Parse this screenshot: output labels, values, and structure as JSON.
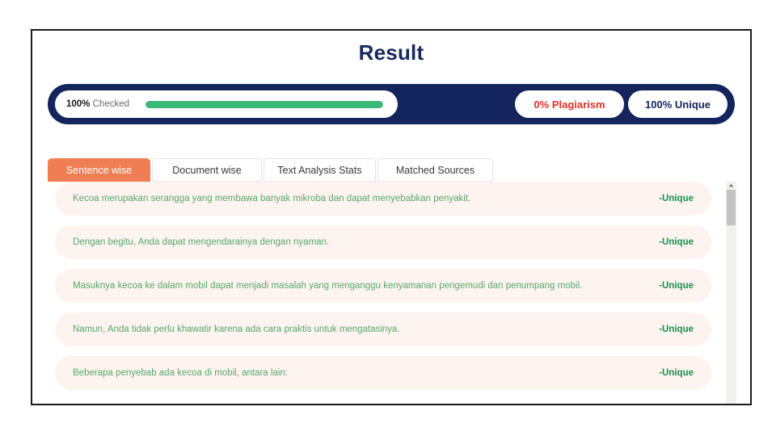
{
  "page": {
    "title": "Result"
  },
  "summary": {
    "progress": {
      "percent_label": "100%",
      "checked_label": "Checked",
      "fill_percent": 100,
      "fill_color": "#3cb878"
    },
    "plagiarism_badge": {
      "label": "0% Plagiarism",
      "color": "#e03228"
    },
    "unique_badge": {
      "label": "100% Unique",
      "color": "#14245c"
    },
    "bar_color": "#14245c"
  },
  "tabs": {
    "active_index": 0,
    "active_color": "#ef7e55",
    "items": [
      {
        "label": "Sentence wise"
      },
      {
        "label": "Document wise"
      },
      {
        "label": "Text Analysis Stats"
      },
      {
        "label": "Matched Sources"
      }
    ]
  },
  "results": {
    "verdict_color": "#1a8f4c",
    "row_background": "#fdf4f0",
    "sentences": [
      {
        "text": "Kecoa merupakan serangga yang membawa banyak mikroba dan dapat menyebabkan penyakit.",
        "verdict": "-Unique"
      },
      {
        "text": "Dengan begitu, Anda dapat mengendarainya dengan nyaman.",
        "verdict": "-Unique"
      },
      {
        "text": "Masuknya kecoa ke dalam mobil dapat menjadi masalah yang menganggu kenyamanan pengemudi dan penumpang mobil.",
        "verdict": "-Unique"
      },
      {
        "text": "Namun, Anda tidak perlu khawatir karena ada cara praktis untuk mengatasinya.",
        "verdict": "-Unique"
      },
      {
        "text": "Beberapa penyebab ada kecoa di mobil, antara lain:",
        "verdict": "-Unique"
      }
    ]
  },
  "scrollbar": {
    "thumb_position_percent": 4
  }
}
